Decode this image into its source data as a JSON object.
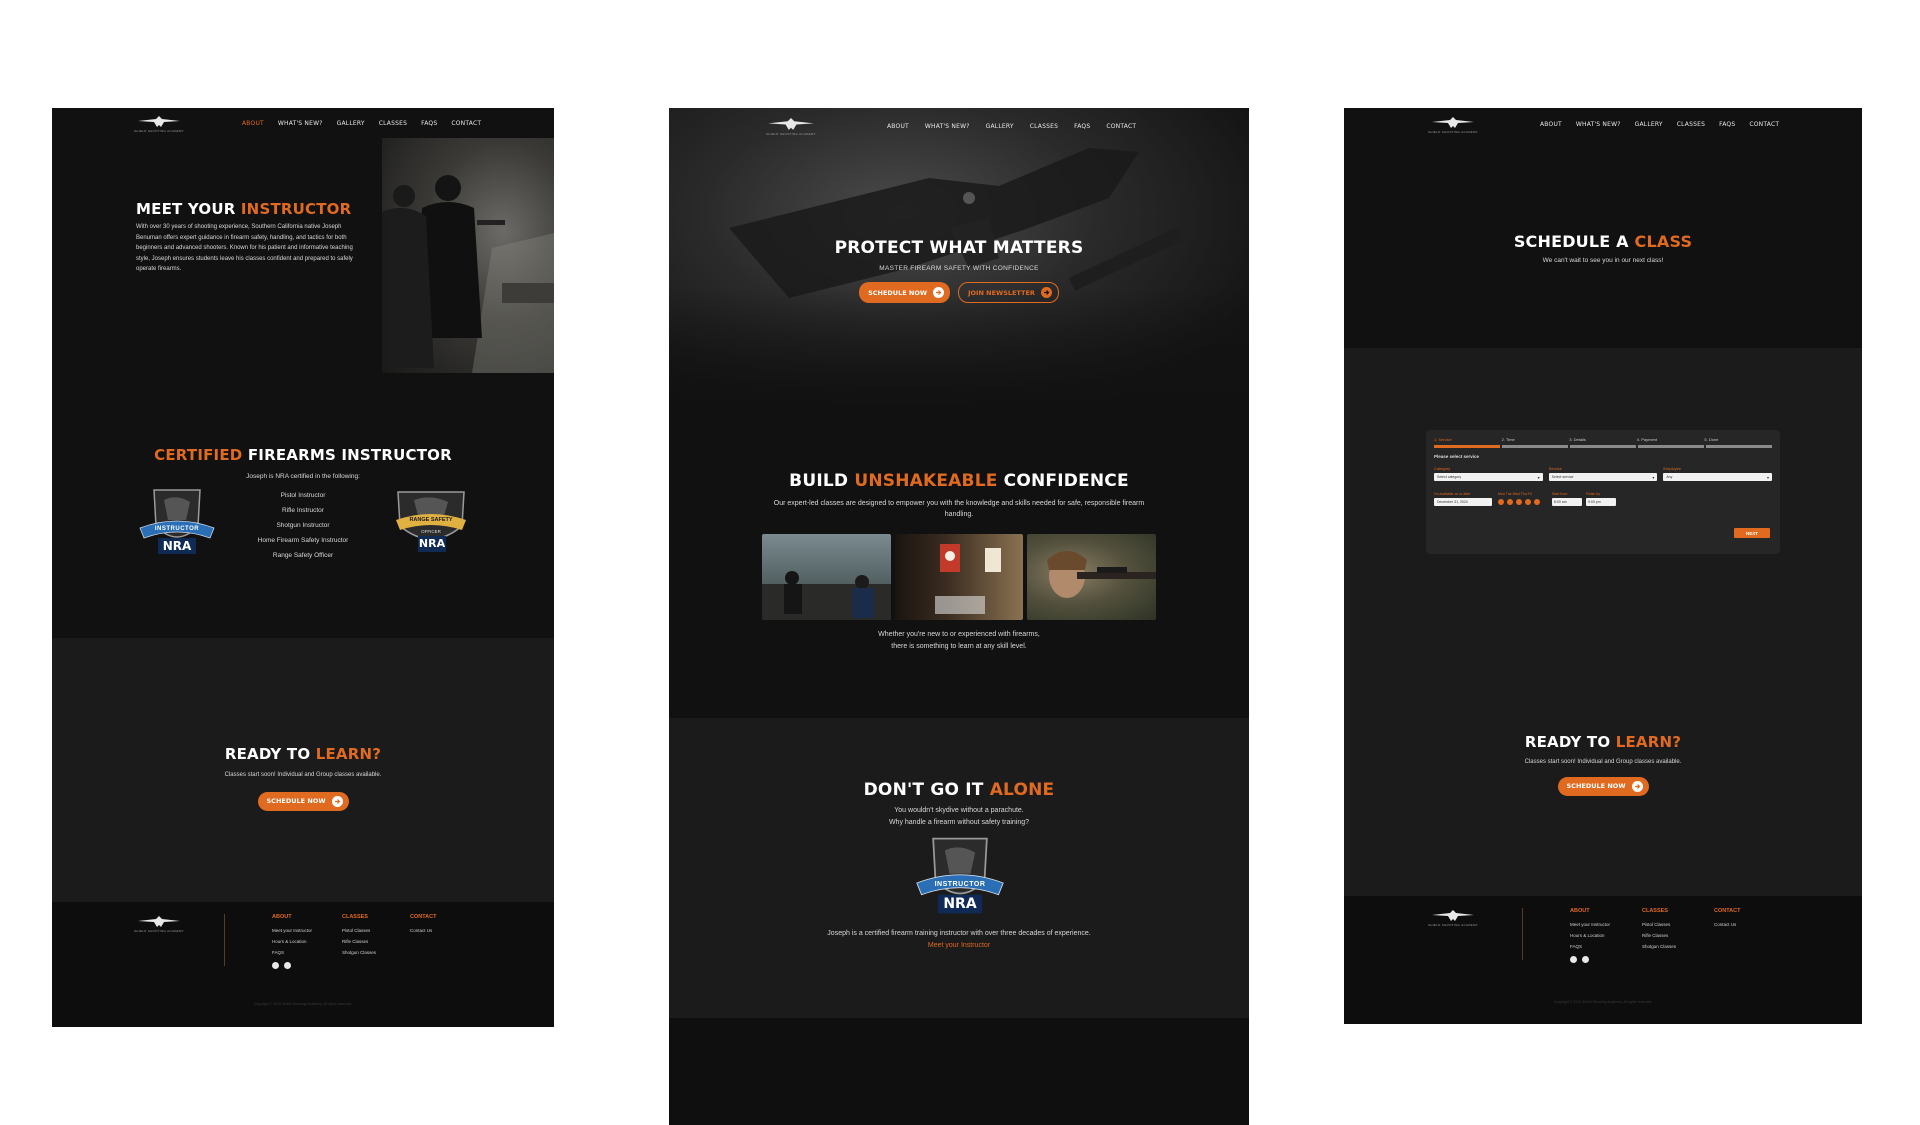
{
  "nav": {
    "logo_text": "SHIELD SHOOTING ACADEMY",
    "items": [
      "ABOUT",
      "WHAT'S NEW?",
      "GALLERY",
      "CLASSES",
      "FAQS",
      "CONTACT"
    ]
  },
  "about_page": {
    "hero_title_prefix": "MEET YOUR ",
    "hero_title_accent": "INSTRUCTOR",
    "hero_body": "With over 30 years of shooting experience, Southern California native Joseph Benuman offers expert guidance in firearm safety, handling, and tactics for both beginners and advanced shooters. Known for his patient and informative teaching style, Joseph ensures students leave his classes confident and prepared to safely operate firearms.",
    "cert_title_accent": "CERTIFIED",
    "cert_title_rest": " FIREARMS INSTRUCTOR",
    "cert_intro": "Joseph is NRA certified in the following:",
    "certs": [
      "Pistol Instructor",
      "Rifle Instructor",
      "Shotgun Instructor",
      "Home Firearm Safety Instructor",
      "Range Safety Officer"
    ],
    "badge_left_top": "INSTRUCTOR",
    "badge_left_bottom": "NRA",
    "badge_right_top": "RANGE SAFETY",
    "badge_right_mid": "OFFICER",
    "badge_right_bottom": "NRA",
    "ready_title_prefix": "READY TO ",
    "ready_title_accent": "LEARN?",
    "ready_body": "Classes start soon! Individual and Group classes available.",
    "ready_button": "SCHEDULE NOW"
  },
  "home_page": {
    "hero_title": "PROTECT WHAT MATTERS",
    "hero_sub": "MASTER FIREARM SAFETY WITH CONFIDENCE",
    "btn_schedule": "SCHEDULE NOW",
    "btn_newsletter": "JOIN NEWSLETTER",
    "build_prefix": "BUILD ",
    "build_accent": "UNSHAKEABLE",
    "build_suffix": " CONFIDENCE",
    "build_body": "Our expert-led classes are designed to empower you with the knowledge and skills needed for safe, responsible firearm handling.",
    "photos_caption_1": "Whether you're new to or experienced with firearms,",
    "photos_caption_2": "there is something to learn at any skill level.",
    "alone_prefix": "DON'T GO IT ",
    "alone_accent": "ALONE",
    "alone_body_1": "You wouldn't skydive without a parachute.",
    "alone_body_2": "Why handle a firearm without safety training?",
    "badge_top": "INSTRUCTOR",
    "badge_bottom": "NRA",
    "alone_footer": "Joseph is a certified firearm training instructor with over three decades of experience.",
    "alone_link": "Meet your Instructor"
  },
  "schedule_page": {
    "title_prefix": "SCHEDULE A ",
    "title_accent": "CLASS",
    "subtitle": "We can't wait to see you in our next class!",
    "steps": [
      "1. Service",
      "2. Time",
      "3. Details",
      "4. Payment",
      "5. Done"
    ],
    "form_heading": "Please select service",
    "label_category": "Category",
    "label_service": "Service",
    "label_employee": "Employee",
    "value_category": "Select category",
    "value_service": "Select service",
    "value_employee": "Any",
    "label_date": "I'm available on or after",
    "value_date": "December 31, 2024",
    "label_days": "Mon Tue Wed Thu Fri",
    "label_start": "Start from",
    "label_finish": "Finish by",
    "value_start": "8:00 am",
    "value_finish": "9:00 pm",
    "next_button": "NEXT",
    "ready_title_prefix": "READY TO ",
    "ready_title_accent": "LEARN?",
    "ready_body": "Classes start soon! Individual and Group classes available.",
    "ready_button": "SCHEDULE NOW"
  },
  "footer": {
    "col1_title": "ABOUT",
    "col1_links": [
      "Meet your Instructor",
      "Hours & Location",
      "FAQS"
    ],
    "col2_title": "CLASSES",
    "col2_links": [
      "Pistol Classes",
      "Rifle Classes",
      "Shotgun Classes"
    ],
    "col3_title": "CONTACT",
    "col3_links": [
      "Contact Us"
    ],
    "copyright": "Copyright © 2024 Shield Shooting Academy. All rights reserved."
  },
  "colors": {
    "accent": "#e06a1f",
    "panel_bg": "#111111",
    "section_bg": "#1b1b1b"
  }
}
